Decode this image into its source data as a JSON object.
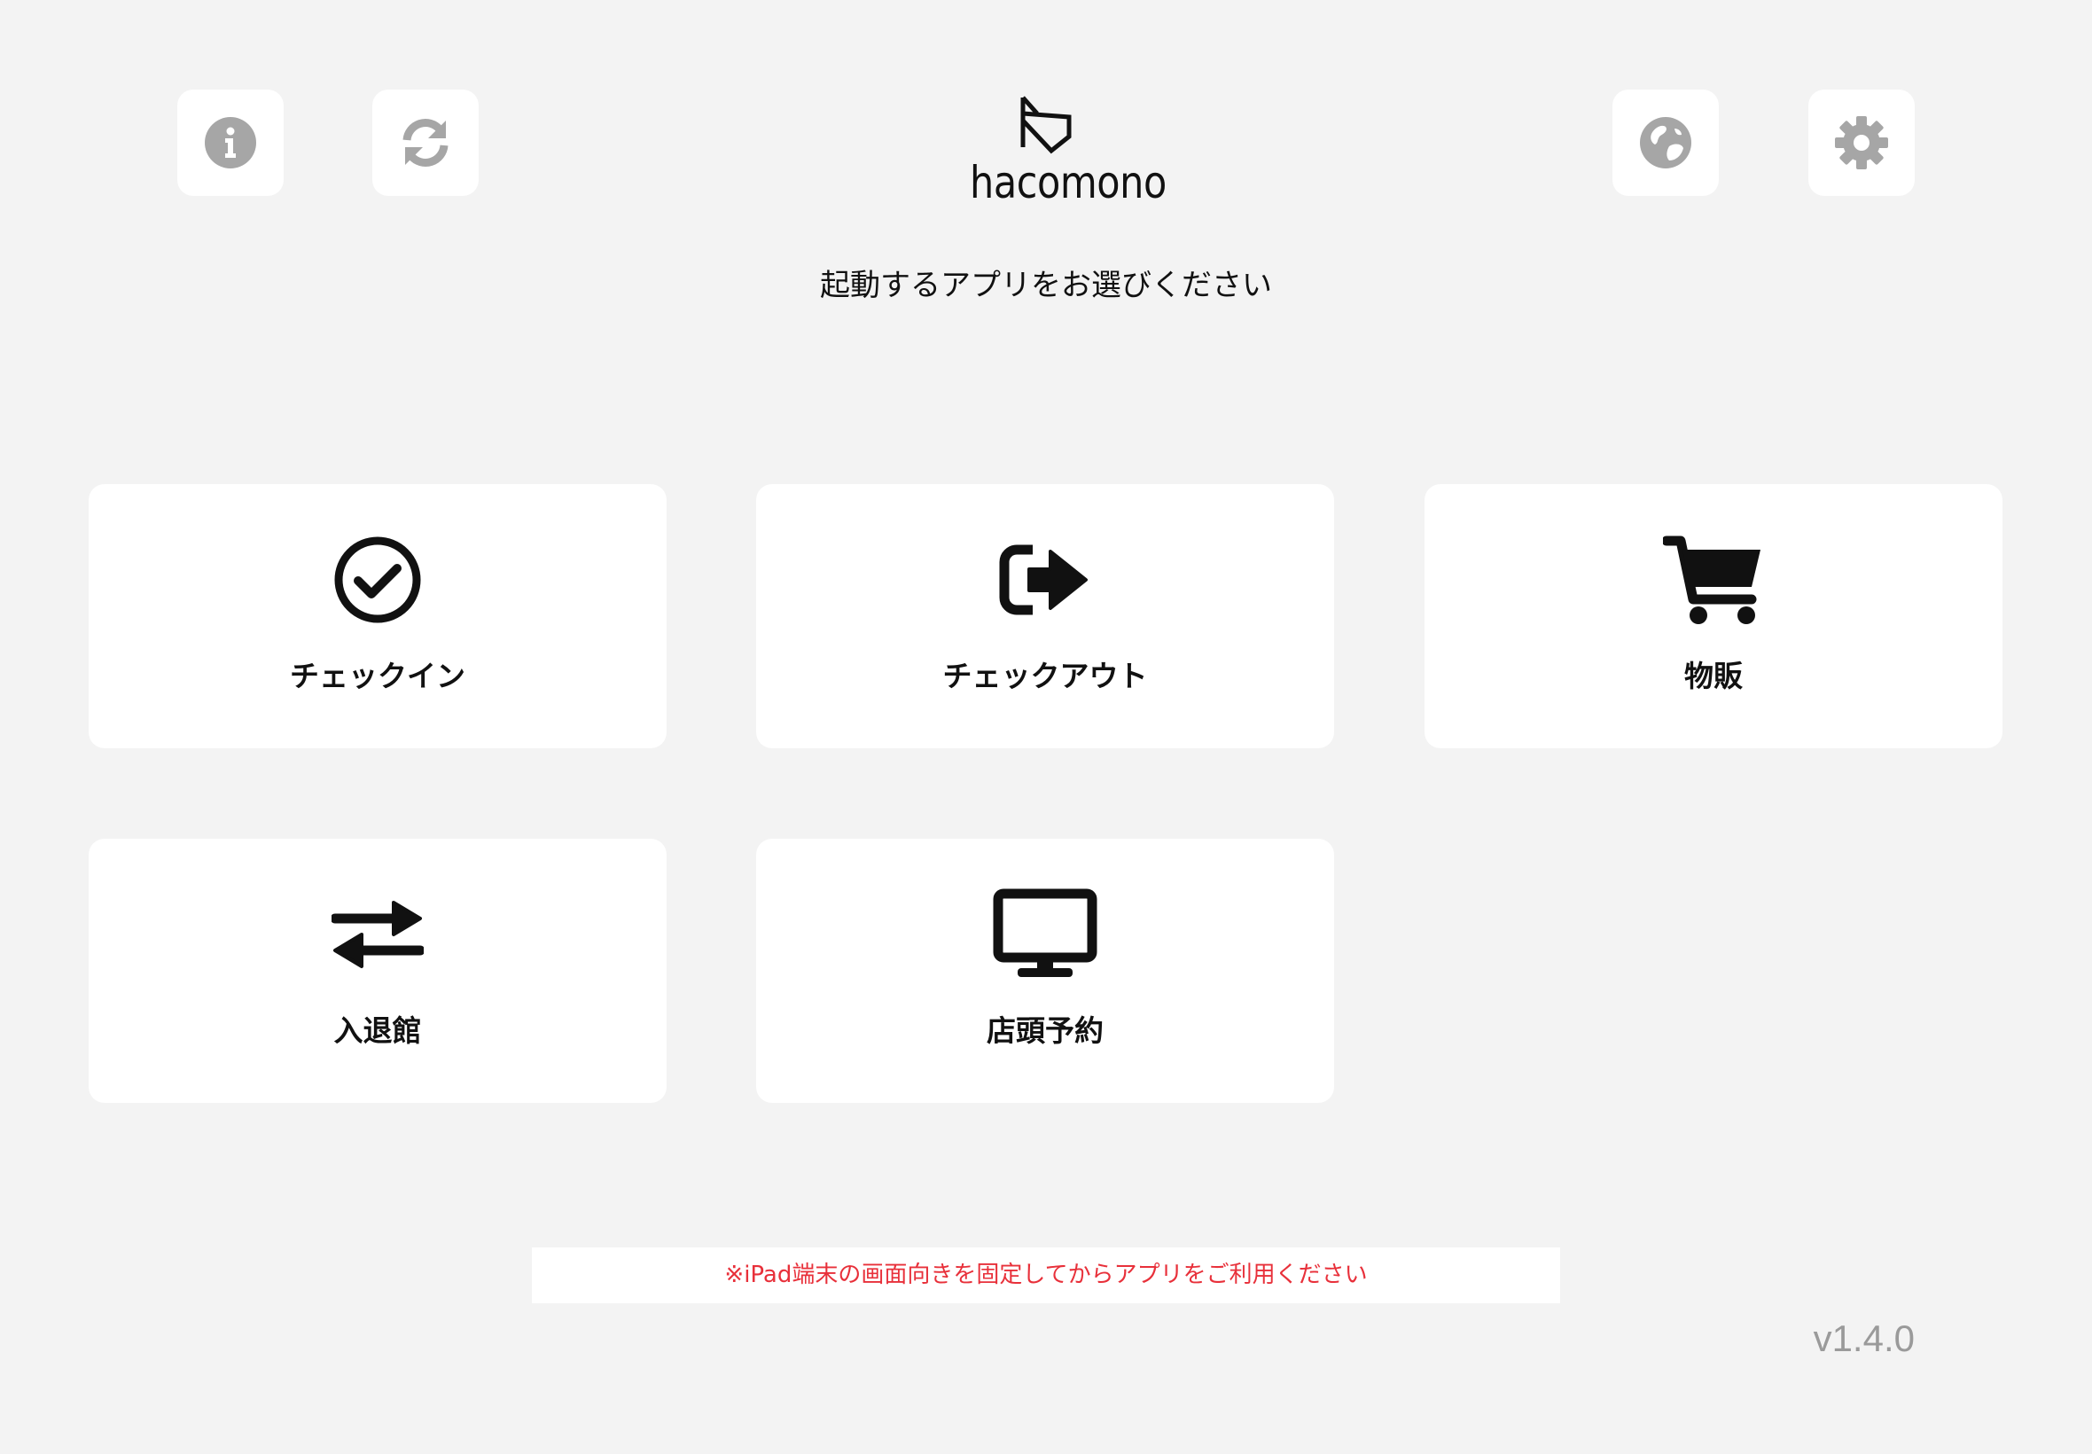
{
  "header": {
    "logo_text": "hacomono",
    "subtitle": "起動するアプリをお選びください",
    "buttons": [
      {
        "name": "info-button",
        "icon": "info-icon"
      },
      {
        "name": "refresh-button",
        "icon": "refresh-icon"
      },
      {
        "name": "language-button",
        "icon": "globe-icon"
      },
      {
        "name": "settings-button",
        "icon": "gear-icon"
      }
    ]
  },
  "apps": [
    {
      "label": "チェックイン",
      "icon": "check-circle-icon"
    },
    {
      "label": "チェックアウト",
      "icon": "sign-out-icon"
    },
    {
      "label": "物販",
      "icon": "shopping-cart-icon"
    },
    {
      "label": "入退館",
      "icon": "exchange-arrows-icon"
    },
    {
      "label": "店頭予約",
      "icon": "monitor-icon"
    }
  ],
  "footer": {
    "notice": "※iPad端末の画面向きを固定してからアプリをご利用ください",
    "version": "v1.4.0"
  },
  "colors": {
    "background": "#f3f3f3",
    "card": "#ffffff",
    "icon_gray": "#a6a6a6",
    "notice_red": "#e8303a",
    "version_gray": "#9a9a9a"
  }
}
